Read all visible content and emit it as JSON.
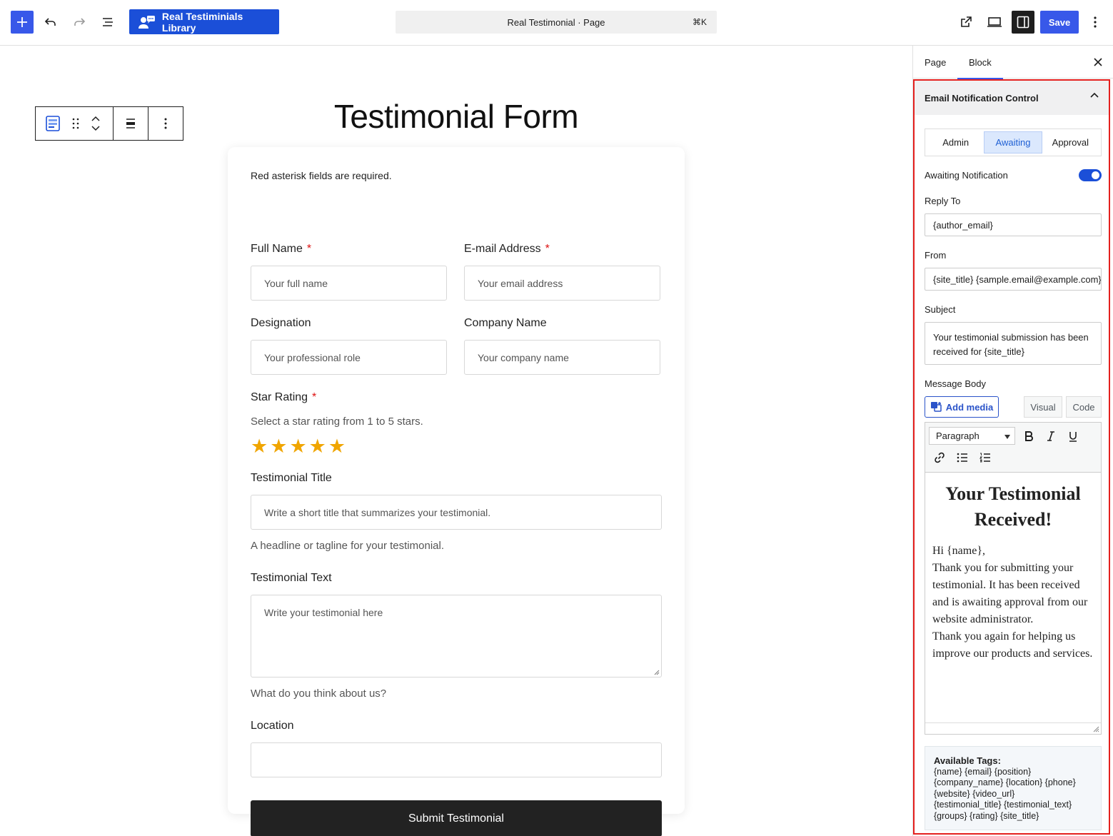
{
  "topbar": {
    "library_button": "Real Testiminials Library",
    "command_title": "Real Testimonial · Page",
    "command_shortcut": "⌘K",
    "save_label": "Save"
  },
  "canvas": {
    "page_title": "Testimonial Form",
    "form": {
      "required_note": "Red asterisk fields are required.",
      "required_mark": "*",
      "fields": {
        "full_name": {
          "label": "Full Name",
          "placeholder": "Your full name"
        },
        "email": {
          "label": "E-mail Address",
          "placeholder": "Your email address"
        },
        "designation": {
          "label": "Designation",
          "placeholder": "Your professional role"
        },
        "company": {
          "label": "Company Name",
          "placeholder": "Your company name"
        },
        "rating": {
          "label": "Star Rating",
          "help": "Select a star rating from 1 to 5 stars.",
          "stars": 5
        },
        "title": {
          "label": "Testimonial Title",
          "placeholder": "Write a short title that summarizes your testimonial.",
          "help": "A headline or tagline for your testimonial."
        },
        "text": {
          "label": "Testimonial Text",
          "placeholder": "Write your testimonial here",
          "help": "What do you think about us?"
        },
        "location": {
          "label": "Location",
          "placeholder": ""
        }
      },
      "submit_label": "Submit Testimonial"
    }
  },
  "sidebar": {
    "tabs": [
      "Page",
      "Block"
    ],
    "active_tab": "Block",
    "panel_title": "Email Notification Control",
    "segments": [
      "Admin",
      "Awaiting",
      "Approval"
    ],
    "active_segment": "Awaiting",
    "awaiting_notification_label": "Awaiting Notification",
    "awaiting_notification_on": true,
    "reply_to": {
      "label": "Reply To",
      "value": "{author_email}"
    },
    "from": {
      "label": "From",
      "value": "{site_title} {sample.email@example.com}"
    },
    "subject": {
      "label": "Subject",
      "value": "Your testimonial submission has been received for {site_title}"
    },
    "message_body": {
      "label": "Message Body",
      "add_media": "Add media",
      "mode_visual": "Visual",
      "mode_code": "Code",
      "format_select": "Paragraph",
      "heading": "Your Testimonial Received!",
      "greeting": "Hi {name},",
      "para1": "Thank you for submitting your testimonial. It has been received and is awaiting approval from our website administrator.",
      "para2": "Thank you again for helping us improve our products and services."
    },
    "available_tags": {
      "title": "Available Tags:",
      "lines": [
        "{name} {email} {position}",
        "{company_name} {location} {phone}",
        "{website} {video_url}",
        "{testimonial_title} {testimonial_text}",
        "{groups} {rating} {site_title}"
      ]
    }
  }
}
